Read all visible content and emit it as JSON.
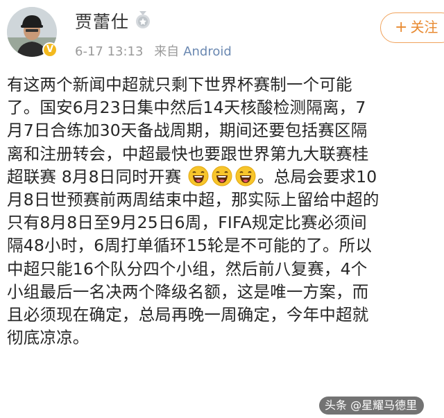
{
  "user": {
    "name": "贾蕾仕",
    "verified_badge": "V",
    "level_icon": "medal-icon",
    "avatar_icon": "avatar-photo"
  },
  "post_meta": {
    "date": "6-17 13:13",
    "source_prefix": "来自",
    "client": "Android"
  },
  "follow_button": {
    "icon": "plus-icon",
    "icon_glyph": "+",
    "label": "关注"
  },
  "post": {
    "lines": [
      "有这两个新闻中超就只剩下世界杯赛制一个可能",
      "了。国安6月23日集中然后14天核酸检测隔离，7",
      "月7日合练加30天备战周期，期间还要包括赛区隔",
      "离和注册转会，中超最快也要跟世界第九大联赛桂",
      "超联赛 8月8日同时开赛",
      "月8日世预赛前两周结束中超，那实际上留给中超的",
      "只有8月8日至9月25日6周，FIFA规定比赛必须间",
      "隔48小时，6周打单循环15轮是不可能的了。所以",
      "中超只能16个队分四个小组，然后前八复赛，4个",
      "小组最后一名决两个降级名额，这是唯一方案，而",
      "且必须现在确定，总局再晚一周确定，今年中超就",
      "彻底凉凉。"
    ],
    "line5_tail": "。总局会要求10",
    "emoji_name": "laughing-emoji",
    "emoji_count": 3
  },
  "watermark": {
    "text": "头条 @星耀马德里"
  },
  "colors": {
    "follow_accent": "#e88a31",
    "meta_gray": "#9a9a9a",
    "client_blue": "#6a88b1",
    "badge_gold": "#f3b91d"
  }
}
